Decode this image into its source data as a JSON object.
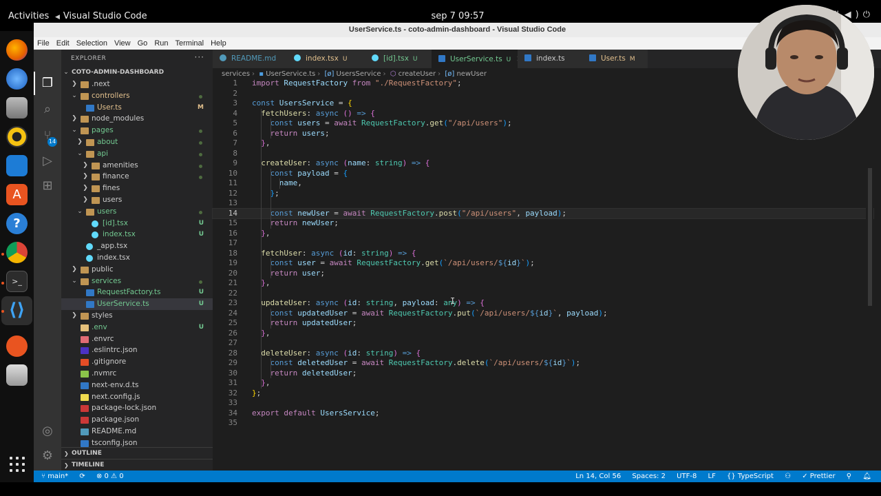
{
  "topbar": {
    "activities": "Activities",
    "app_name": "Visual Studio Code",
    "clock": "sep 7  09:57"
  },
  "window": {
    "title": "UserService.ts - coto-admin-dashboard - Visual Studio Code"
  },
  "menu": [
    "File",
    "Edit",
    "Selection",
    "View",
    "Go",
    "Run",
    "Terminal",
    "Help"
  ],
  "activitybar": {
    "scm_badge": "14"
  },
  "explorer": {
    "header": "EXPLORER",
    "actions": "···",
    "root": "COTO-ADMIN-DASHBOARD",
    "items": [
      {
        "name": ".next",
        "depth": 1,
        "type": "folder",
        "open": false,
        "color": "#cccccc",
        "badge": ""
      },
      {
        "name": "controllers",
        "depth": 1,
        "type": "folder",
        "open": true,
        "color": "#e2c08d",
        "badge": "",
        "dot": true
      },
      {
        "name": "User.ts",
        "depth": 2,
        "type": "ts",
        "color": "#e2c08d",
        "badge": "M"
      },
      {
        "name": "node_modules",
        "depth": 1,
        "type": "folder",
        "open": false,
        "color": "#cccccc",
        "badge": ""
      },
      {
        "name": "pages",
        "depth": 1,
        "type": "folder",
        "open": true,
        "color": "#73c991",
        "badge": "",
        "dot": true
      },
      {
        "name": "about",
        "depth": 2,
        "type": "folder",
        "open": false,
        "color": "#73c991",
        "badge": "",
        "dot": true
      },
      {
        "name": "api",
        "depth": 2,
        "type": "folder",
        "open": true,
        "color": "#73c991",
        "badge": "",
        "dot": true
      },
      {
        "name": "amenities",
        "depth": 3,
        "type": "folder",
        "open": false,
        "color": "#cccccc",
        "badge": "",
        "dot": true
      },
      {
        "name": "finance",
        "depth": 3,
        "type": "folder",
        "open": false,
        "color": "#cccccc",
        "badge": "",
        "dot": true
      },
      {
        "name": "fines",
        "depth": 3,
        "type": "folder",
        "open": false,
        "color": "#cccccc",
        "badge": ""
      },
      {
        "name": "users",
        "depth": 3,
        "type": "folder",
        "open": false,
        "color": "#cccccc",
        "badge": ""
      },
      {
        "name": "users",
        "depth": 2,
        "type": "folder",
        "open": true,
        "color": "#73c991",
        "badge": "",
        "dot": true
      },
      {
        "name": "[id].tsx",
        "depth": 3,
        "type": "react",
        "color": "#73c991",
        "badge": "U"
      },
      {
        "name": "index.tsx",
        "depth": 3,
        "type": "react",
        "color": "#73c991",
        "badge": "U"
      },
      {
        "name": "_app.tsx",
        "depth": 2,
        "type": "react",
        "color": "#cccccc",
        "badge": ""
      },
      {
        "name": "index.tsx",
        "depth": 2,
        "type": "react",
        "color": "#cccccc",
        "badge": ""
      },
      {
        "name": "public",
        "depth": 1,
        "type": "folder",
        "open": false,
        "color": "#cccccc",
        "badge": ""
      },
      {
        "name": "services",
        "depth": 1,
        "type": "folder",
        "open": true,
        "color": "#73c991",
        "badge": "",
        "dot": true
      },
      {
        "name": "RequestFactory.ts",
        "depth": 2,
        "type": "ts",
        "color": "#73c991",
        "badge": "U"
      },
      {
        "name": "UserService.ts",
        "depth": 2,
        "type": "ts",
        "color": "#73c991",
        "badge": "U",
        "selected": true
      },
      {
        "name": "styles",
        "depth": 1,
        "type": "folder",
        "open": false,
        "color": "#cccccc",
        "badge": ""
      },
      {
        "name": ".env",
        "depth": 1,
        "type": "env",
        "color": "#73c991",
        "badge": "U"
      },
      {
        "name": ".envrc",
        "depth": 1,
        "type": "envrc",
        "color": "#cccccc",
        "badge": ""
      },
      {
        "name": ".eslintrc.json",
        "depth": 1,
        "type": "eslint",
        "color": "#cccccc",
        "badge": ""
      },
      {
        "name": ".gitignore",
        "depth": 1,
        "type": "git",
        "color": "#cccccc",
        "badge": ""
      },
      {
        "name": ".nvmrc",
        "depth": 1,
        "type": "nvm",
        "color": "#cccccc",
        "badge": ""
      },
      {
        "name": "next-env.d.ts",
        "depth": 1,
        "type": "ts",
        "color": "#cccccc",
        "badge": ""
      },
      {
        "name": "next.config.js",
        "depth": 1,
        "type": "js",
        "color": "#cccccc",
        "badge": ""
      },
      {
        "name": "package-lock.json",
        "depth": 1,
        "type": "npm",
        "color": "#cccccc",
        "badge": ""
      },
      {
        "name": "package.json",
        "depth": 1,
        "type": "npm",
        "color": "#cccccc",
        "badge": ""
      },
      {
        "name": "README.md",
        "depth": 1,
        "type": "md",
        "color": "#cccccc",
        "badge": ""
      },
      {
        "name": "tsconfig.json",
        "depth": 1,
        "type": "tsconfig",
        "color": "#cccccc",
        "badge": ""
      }
    ],
    "outline": "OUTLINE",
    "timeline": "TIMELINE"
  },
  "tabs": [
    {
      "label": "README.md",
      "mod": "",
      "icon": "info-icon",
      "color": "#519aba"
    },
    {
      "label": "index.tsx",
      "mod": "U",
      "icon": "react-icon",
      "color": "#e2c08d"
    },
    {
      "label": "[id].tsx",
      "mod": "U",
      "icon": "react-icon",
      "color": "#73c991"
    },
    {
      "label": "UserService.ts",
      "mod": "U",
      "icon": "ts-icon",
      "color": "#73c991",
      "active": true,
      "close": "✕"
    },
    {
      "label": "index.ts",
      "mod": "",
      "icon": "ts-icon",
      "color": "#cccccc"
    },
    {
      "label": "User.ts",
      "mod": "M",
      "icon": "ts-icon",
      "color": "#e2c08d"
    }
  ],
  "breadcrumb": [
    "services",
    "UserService.ts",
    "UsersService",
    "createUser",
    "newUser"
  ],
  "editor": {
    "current_line": 14,
    "lines": [
      [
        [
          "kw2",
          "import "
        ],
        [
          "var",
          "RequestFactory "
        ],
        [
          "kw2",
          "from "
        ],
        [
          "str",
          "\"./RequestFactory\""
        ],
        [
          "",
          "; "
        ]
      ],
      [],
      [
        [
          "kw",
          "const "
        ],
        [
          "var",
          "UsersService "
        ],
        [
          "",
          "= "
        ],
        [
          "br1",
          "{"
        ]
      ],
      [
        [
          "",
          "  "
        ],
        [
          "fn",
          "fetchUsers"
        ],
        [
          "",
          ": "
        ],
        [
          "kw",
          "async "
        ],
        [
          "br2",
          "()"
        ],
        [
          "kw",
          " => "
        ],
        [
          "br2",
          "{"
        ]
      ],
      [
        [
          "",
          "    "
        ],
        [
          "kw",
          "const "
        ],
        [
          "var",
          "users "
        ],
        [
          "",
          "= "
        ],
        [
          "kw2",
          "await "
        ],
        [
          "cls",
          "RequestFactory"
        ],
        [
          "",
          "."
        ],
        [
          "fn",
          "get"
        ],
        [
          "br3",
          "("
        ],
        [
          "str",
          "\"/api/users\""
        ],
        [
          "br3",
          ")"
        ],
        [
          "",
          ";"
        ]
      ],
      [
        [
          "",
          "    "
        ],
        [
          "kw2",
          "return "
        ],
        [
          "var",
          "users"
        ],
        [
          "",
          ";"
        ]
      ],
      [
        [
          "",
          "  "
        ],
        [
          "br2",
          "}"
        ],
        [
          "",
          ","
        ]
      ],
      [],
      [
        [
          "",
          "  "
        ],
        [
          "fn",
          "createUser"
        ],
        [
          "",
          ": "
        ],
        [
          "kw",
          "async "
        ],
        [
          "br2",
          "("
        ],
        [
          "var",
          "name"
        ],
        [
          "",
          ": "
        ],
        [
          "cls",
          "string"
        ],
        [
          "br2",
          ")"
        ],
        [
          "kw",
          " => "
        ],
        [
          "br2",
          "{"
        ]
      ],
      [
        [
          "",
          "    "
        ],
        [
          "kw",
          "const "
        ],
        [
          "var",
          "payload "
        ],
        [
          "",
          "= "
        ],
        [
          "br3",
          "{"
        ]
      ],
      [
        [
          "",
          "      "
        ],
        [
          "var",
          "name"
        ],
        [
          "",
          ","
        ]
      ],
      [
        [
          "",
          "    "
        ],
        [
          "br3",
          "}"
        ],
        [
          "",
          ";"
        ]
      ],
      [],
      [
        [
          "",
          "    "
        ],
        [
          "kw",
          "const "
        ],
        [
          "var",
          "newUser "
        ],
        [
          "",
          "= "
        ],
        [
          "kw2",
          "await "
        ],
        [
          "cls",
          "RequestFactory"
        ],
        [
          "",
          "."
        ],
        [
          "fn",
          "post"
        ],
        [
          "br3",
          "("
        ],
        [
          "str",
          "\"/api/users\""
        ],
        [
          "",
          ", "
        ],
        [
          "var",
          "payload"
        ],
        [
          "br3",
          ")"
        ],
        [
          "",
          ";"
        ]
      ],
      [
        [
          "",
          "    "
        ],
        [
          "kw2",
          "return "
        ],
        [
          "var",
          "newUser"
        ],
        [
          "",
          ";"
        ]
      ],
      [
        [
          "",
          "  "
        ],
        [
          "br2",
          "}"
        ],
        [
          "",
          ","
        ]
      ],
      [],
      [
        [
          "",
          "  "
        ],
        [
          "fn",
          "fetchUser"
        ],
        [
          "",
          ": "
        ],
        [
          "kw",
          "async "
        ],
        [
          "br2",
          "("
        ],
        [
          "var",
          "id"
        ],
        [
          "",
          ": "
        ],
        [
          "cls",
          "string"
        ],
        [
          "br2",
          ")"
        ],
        [
          "kw",
          " => "
        ],
        [
          "br2",
          "{"
        ]
      ],
      [
        [
          "",
          "    "
        ],
        [
          "kw",
          "const "
        ],
        [
          "var",
          "user "
        ],
        [
          "",
          "= "
        ],
        [
          "kw2",
          "await "
        ],
        [
          "cls",
          "RequestFactory"
        ],
        [
          "",
          "."
        ],
        [
          "fn",
          "get"
        ],
        [
          "br3",
          "("
        ],
        [
          "str",
          "`/api/users/"
        ],
        [
          "kw",
          "${"
        ],
        [
          "var",
          "id"
        ],
        [
          "kw",
          "}"
        ],
        [
          "str",
          "`"
        ],
        [
          "br3",
          ")"
        ],
        [
          "",
          ";"
        ]
      ],
      [
        [
          "",
          "    "
        ],
        [
          "kw2",
          "return "
        ],
        [
          "var",
          "user"
        ],
        [
          "",
          ";"
        ]
      ],
      [
        [
          "",
          "  "
        ],
        [
          "br2",
          "}"
        ],
        [
          "",
          ","
        ]
      ],
      [],
      [
        [
          "",
          "  "
        ],
        [
          "fn",
          "updateUser"
        ],
        [
          "",
          ": "
        ],
        [
          "kw",
          "async "
        ],
        [
          "br2",
          "("
        ],
        [
          "var",
          "id"
        ],
        [
          "",
          ": "
        ],
        [
          "cls",
          "string"
        ],
        [
          "",
          ", "
        ],
        [
          "var",
          "payload"
        ],
        [
          "",
          ": "
        ],
        [
          "cls",
          "any"
        ],
        [
          "br2",
          ")"
        ],
        [
          "kw",
          " => "
        ],
        [
          "br2",
          "{"
        ]
      ],
      [
        [
          "",
          "    "
        ],
        [
          "kw",
          "const "
        ],
        [
          "var",
          "updatedUser "
        ],
        [
          "",
          "= "
        ],
        [
          "kw2",
          "await "
        ],
        [
          "cls",
          "RequestFactory"
        ],
        [
          "",
          "."
        ],
        [
          "fn",
          "put"
        ],
        [
          "br3",
          "("
        ],
        [
          "str",
          "`/api/users/"
        ],
        [
          "kw",
          "${"
        ],
        [
          "var",
          "id"
        ],
        [
          "kw",
          "}"
        ],
        [
          "str",
          "`"
        ],
        [
          "",
          ", "
        ],
        [
          "var",
          "payload"
        ],
        [
          "br3",
          ")"
        ],
        [
          "",
          ";"
        ]
      ],
      [
        [
          "",
          "    "
        ],
        [
          "kw2",
          "return "
        ],
        [
          "var",
          "updatedUser"
        ],
        [
          "",
          ";"
        ]
      ],
      [
        [
          "",
          "  "
        ],
        [
          "br2",
          "}"
        ],
        [
          "",
          ","
        ]
      ],
      [],
      [
        [
          "",
          "  "
        ],
        [
          "fn",
          "deleteUser"
        ],
        [
          "",
          ": "
        ],
        [
          "kw",
          "async "
        ],
        [
          "br2",
          "("
        ],
        [
          "var",
          "id"
        ],
        [
          "",
          ": "
        ],
        [
          "cls",
          "string"
        ],
        [
          "br2",
          ")"
        ],
        [
          "kw",
          " => "
        ],
        [
          "br2",
          "{"
        ]
      ],
      [
        [
          "",
          "    "
        ],
        [
          "kw",
          "const "
        ],
        [
          "var",
          "deletedUser "
        ],
        [
          "",
          "= "
        ],
        [
          "kw2",
          "await "
        ],
        [
          "cls",
          "RequestFactory"
        ],
        [
          "",
          "."
        ],
        [
          "fn",
          "delete"
        ],
        [
          "br3",
          "("
        ],
        [
          "str",
          "`/api/users/"
        ],
        [
          "kw",
          "${"
        ],
        [
          "var",
          "id"
        ],
        [
          "kw",
          "}"
        ],
        [
          "str",
          "`"
        ],
        [
          "br3",
          ")"
        ],
        [
          "",
          ";"
        ]
      ],
      [
        [
          "",
          "    "
        ],
        [
          "kw2",
          "return "
        ],
        [
          "var",
          "deletedUser"
        ],
        [
          "",
          ";"
        ]
      ],
      [
        [
          "",
          "  "
        ],
        [
          "br2",
          "}"
        ],
        [
          "",
          ","
        ]
      ],
      [
        [
          "br1",
          "}"
        ],
        [
          "",
          ";"
        ]
      ],
      [],
      [
        [
          "kw2",
          "export default "
        ],
        [
          "var",
          "UsersService"
        ],
        [
          "",
          ";"
        ]
      ],
      []
    ]
  },
  "statusbar": {
    "branch": "main*",
    "sync": "⟳",
    "problems": "⊗ 0 ⚠ 0",
    "position": "Ln 14, Col 56",
    "spaces": "Spaces: 2",
    "encoding": "UTF-8",
    "eol": "LF",
    "language": "{} TypeScript",
    "prettier": "✓ Prettier"
  },
  "colors": {
    "accent": "#007acc",
    "modified": "#e2c08d",
    "untracked": "#73c991"
  }
}
